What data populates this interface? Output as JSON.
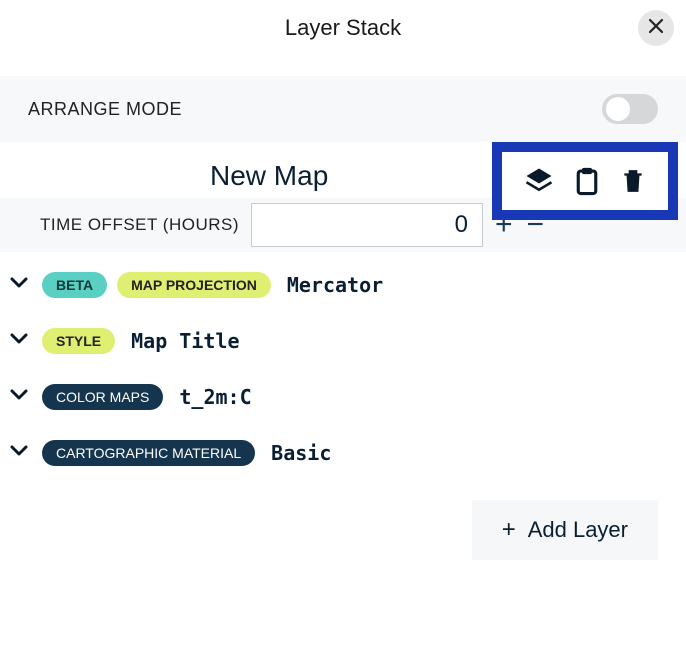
{
  "header": {
    "title": "Layer Stack"
  },
  "arrange": {
    "label": "ARRANGE MODE",
    "enabled": false
  },
  "map": {
    "title": "New Map"
  },
  "time_offset": {
    "label": "TIME OFFSET (HOURS)",
    "value": "0"
  },
  "layers": [
    {
      "badges": [
        {
          "text": "BETA",
          "style": "teal"
        },
        {
          "text": "MAP PROJECTION",
          "style": "lime"
        }
      ],
      "value": "Mercator"
    },
    {
      "badges": [
        {
          "text": "STYLE",
          "style": "lime"
        }
      ],
      "value": "Map Title"
    },
    {
      "badges": [
        {
          "text": "COLOR MAPS",
          "style": "navy"
        }
      ],
      "value": "t_2m:C"
    },
    {
      "badges": [
        {
          "text": "CARTOGRAPHIC MATERIAL",
          "style": "navy"
        }
      ],
      "value": "Basic"
    }
  ],
  "add_layer_label": "Add Layer",
  "icons": {
    "layers": "layers-icon",
    "clipboard": "clipboard-icon",
    "trash": "trash-icon",
    "close": "close-icon"
  }
}
